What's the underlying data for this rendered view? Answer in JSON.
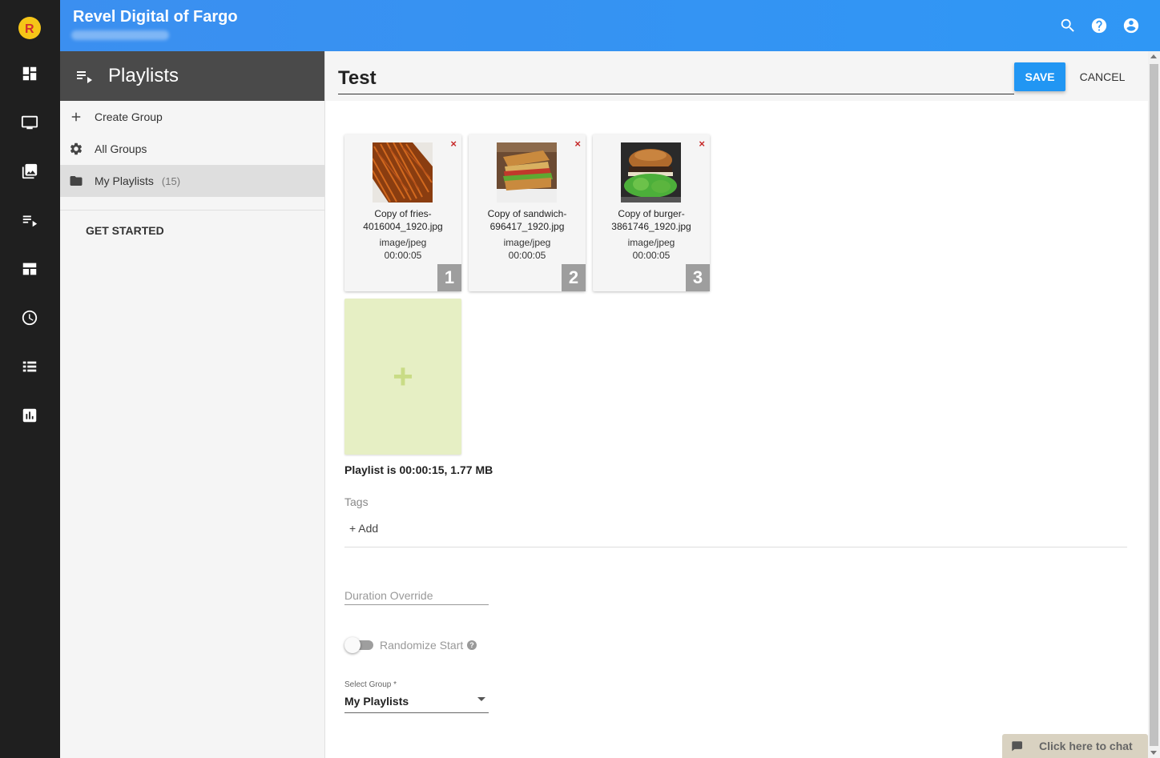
{
  "header": {
    "org_name": "Revel Digital of Fargo",
    "icons": [
      "search-icon",
      "help-icon",
      "account-icon"
    ]
  },
  "rail": {
    "items": [
      "dashboard-icon",
      "monitor-icon",
      "media-icon",
      "playlist-icon",
      "template-icon",
      "schedule-icon",
      "list-icon",
      "reports-icon"
    ]
  },
  "sidebar": {
    "title": "Playlists",
    "create_group": "Create Group",
    "all_groups": "All Groups",
    "my_playlists": "My Playlists",
    "my_playlists_count": "(15)",
    "get_started": "GET STARTED"
  },
  "editor": {
    "playlist_name": "Test",
    "save_label": "SAVE",
    "cancel_label": "CANCEL",
    "remove_glyph": "×",
    "add_glyph": "+",
    "items": [
      {
        "name": "Copy of fries-4016004_1920.jpg",
        "type": "image/jpeg",
        "duration": "00:00:05",
        "index": "1",
        "thumb": "fries"
      },
      {
        "name": "Copy of sandwich-696417_1920.jpg",
        "type": "image/jpeg",
        "duration": "00:00:05",
        "index": "2",
        "thumb": "sandwich"
      },
      {
        "name": "Copy of burger-3861746_1920.jpg",
        "type": "image/jpeg",
        "duration": "00:00:05",
        "index": "3",
        "thumb": "burger"
      }
    ],
    "summary": "Playlist is 00:00:15, 1.77 MB",
    "tags_label": "Tags",
    "tags_add": "+ Add",
    "duration_placeholder": "Duration Override",
    "randomize_label": "Randomize Start",
    "randomize_on": false,
    "help_glyph": "?",
    "select_group_label": "Select Group *",
    "select_group_value": "My Playlists"
  },
  "chat": {
    "label": "Click here to chat"
  },
  "colors": {
    "header": "#2f97f5",
    "rail": "#1f1f1f",
    "sidebar_head": "#4a4a4a",
    "save_button": "#2196f3",
    "remove": "#c62828",
    "add_tile": "#e6efc4"
  }
}
